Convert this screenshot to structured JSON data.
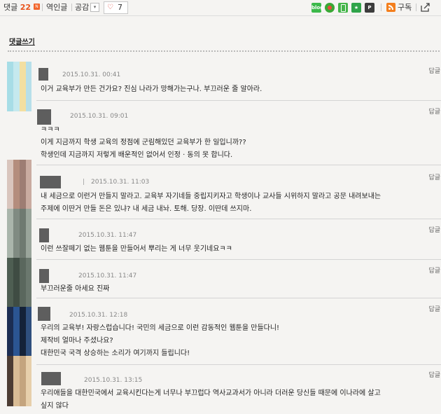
{
  "topbar": {
    "comments_label": "댓글",
    "comments_count": "22",
    "new_badge": "N",
    "popular_label": "역인글",
    "empathy_label": "공감",
    "dropdown_glyph": "▾",
    "like_count": "7",
    "subscribe_label": "구독",
    "share_icons": [
      {
        "icon": "blog-share-icon",
        "text": "blog",
        "color": "#3cb94b"
      },
      {
        "icon": "circle-share-icon",
        "text": "",
        "color": "#3aa836"
      },
      {
        "icon": "mobile-share-icon",
        "text": "",
        "color": "#44b549"
      },
      {
        "icon": "star-share-icon",
        "text": "★",
        "color": "#2fa44a"
      },
      {
        "icon": "p-share-icon",
        "text": "P",
        "color": "#3d3d3d"
      }
    ]
  },
  "write_comment_label": "댓글쓰기",
  "reply_label": "답글",
  "comments": [
    {
      "date": "2015.10.31. 00:41",
      "lines": [
        "이거 교육부가 만든 건가요? 진심 나라가 망해가는구나. 부끄러운 줄 알아라."
      ],
      "avatar_colors": [
        "#a7dde6",
        "#c5e9ee",
        "#f3dfa1",
        "#b7dfe9"
      ]
    },
    {
      "date": "2015.10.31. 09:01",
      "lines": [
        "ㅋㅋㅋ",
        "이게 지금까지 학생 교육의 정점에 군림해있던 교육부가 한 일입니까??",
        "학생인데 지금까지 저렇게 배운적인 없어서 인정 · 동의 못 합니다."
      ],
      "avatar_colors": []
    },
    {
      "date": "2015.10.31. 11:03",
      "bar": "|",
      "lines": [
        "내 세금으로 이런거 만들지 말라고. 교육부 자기네들 중립지키자고 학생이나 교사들 시위하지 말라고 공문 내려보내는",
        "주제에 이딴거 만들 돈은 있냐? 내 세금 내놔. 토해. 당장. 이딴데 쓰지마."
      ],
      "avatar_colors": [
        "#d9c5bd",
        "#b48d7d",
        "#9d7d73",
        "#c9aba0"
      ]
    },
    {
      "date": "2015.10.31. 11:47",
      "lines": [
        "이런 쓰잘떼기 없는 웹툰을 만들어서 뿌리는 게 너무 웃기네요ㅋㅋ"
      ],
      "avatar_colors": [
        "#aab5ab",
        "#808b82",
        "#6f7a71",
        "#9aa59b"
      ]
    },
    {
      "date": "2015.10.31. 11:47",
      "lines": [
        "부끄러운줄 아세요 진짜"
      ],
      "avatar_colors": [
        "#4e5e52",
        "#3f4c43",
        "#5a675d",
        "#6b786e"
      ]
    },
    {
      "date": "2015.10.31. 12:18",
      "lines": [
        "우리의 교육부! 자랑스럽습니다! 국민의 세금으로 이런 감동적인 웹툰을 만들다니!",
        "제작비 얼마나 주셨나요?",
        "대한민국 국격 상승하는 소리가 여기까지 들립니다!"
      ],
      "avatar_colors": [
        "#1b2d52",
        "#2b5592",
        "#142238",
        "#2f4f7d"
      ]
    },
    {
      "date": "2015.10.31. 13:15",
      "lines": [
        "우리애들을 대한민국에서 교육시킨다는게 너무나 부끄럽다 역사교과서가 아니라 더러운 당신들 때문에 이나라에 살고",
        "싶지 않다"
      ],
      "avatar_colors": [
        "#4c3c33",
        "#d9bc95",
        "#c4a47e",
        "#e7cfab"
      ]
    }
  ]
}
